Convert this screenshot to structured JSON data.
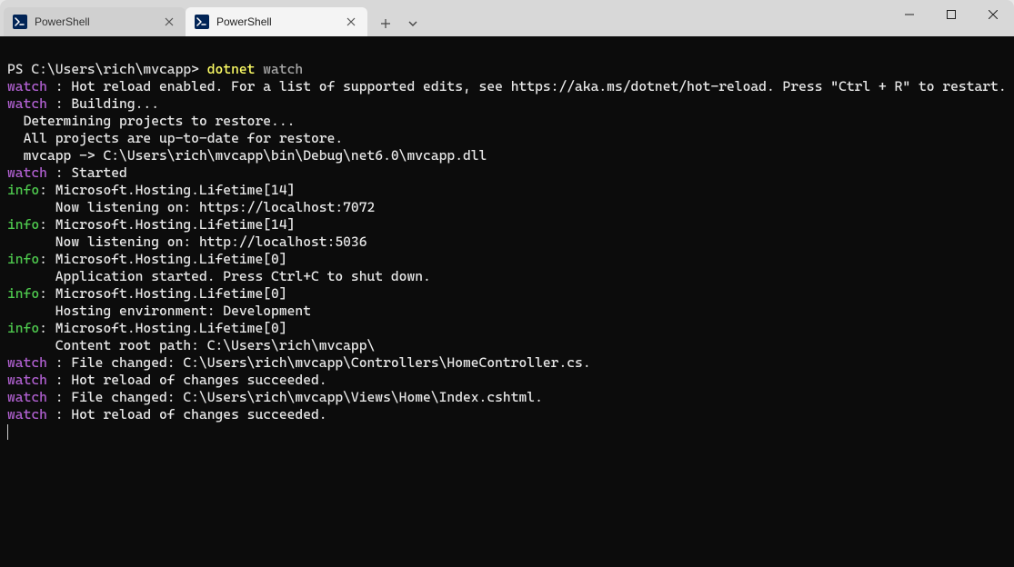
{
  "tabs": [
    {
      "label": "PowerShell",
      "active": false
    },
    {
      "label": "PowerShell",
      "active": true
    }
  ],
  "prompt": {
    "prefix": "PS C:\\Users\\rich\\mvcapp> ",
    "command_main": "dotnet",
    "command_arg": " watch"
  },
  "lines": {
    "l1a": "watch ",
    "l1b": ": Hot reload enabled. For a list of supported edits, see https://aka.ms/dotnet/hot-reload. Press \"Ctrl + R\" to restart.",
    "l2a": "watch ",
    "l2b": ": Building...",
    "l3": "  Determining projects to restore...",
    "l4": "  All projects are up-to-date for restore.",
    "l5": "  mvcapp -> C:\\Users\\rich\\mvcapp\\bin\\Debug\\net6.0\\mvcapp.dll",
    "l6a": "watch ",
    "l6b": ": Started",
    "l7a": "info",
    "l7b": ": Microsoft.Hosting.Lifetime[14]",
    "l8": "      Now listening on: https://localhost:7072",
    "l9a": "info",
    "l9b": ": Microsoft.Hosting.Lifetime[14]",
    "l10": "      Now listening on: http://localhost:5036",
    "l11a": "info",
    "l11b": ": Microsoft.Hosting.Lifetime[0]",
    "l12": "      Application started. Press Ctrl+C to shut down.",
    "l13a": "info",
    "l13b": ": Microsoft.Hosting.Lifetime[0]",
    "l14": "      Hosting environment: Development",
    "l15a": "info",
    "l15b": ": Microsoft.Hosting.Lifetime[0]",
    "l16": "      Content root path: C:\\Users\\rich\\mvcapp\\",
    "l17a": "watch ",
    "l17b": ": File changed: C:\\Users\\rich\\mvcapp\\Controllers\\HomeController.cs.",
    "l18a": "watch ",
    "l18b": ": Hot reload of changes succeeded.",
    "l19a": "watch ",
    "l19b": ": File changed: C:\\Users\\rich\\mvcapp\\Views\\Home\\Index.cshtml.",
    "l20a": "watch ",
    "l20b": ": Hot reload of changes succeeded."
  }
}
